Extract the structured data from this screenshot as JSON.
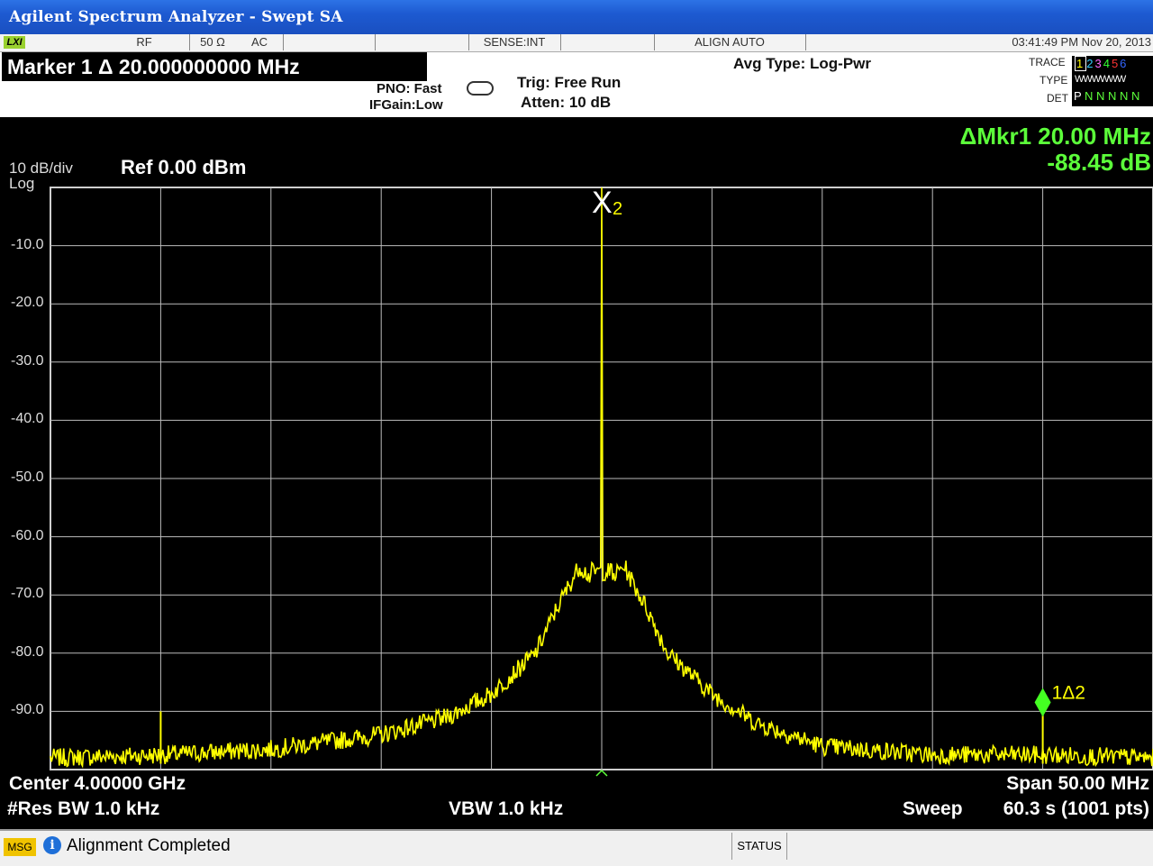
{
  "window": {
    "title": "Agilent Spectrum Analyzer - Swept SA"
  },
  "status_bar": {
    "lxi": "LXI",
    "rf": "RF",
    "impedance": "50 Ω",
    "coupling": "AC",
    "sense": "SENSE:INT",
    "align": "ALIGN AUTO",
    "datetime": "03:41:49 PM Nov 20, 2013"
  },
  "marker_readout": "Marker 1 Δ  20.000000000 MHz",
  "settings": {
    "pno": "PNO: Fast",
    "ifgain": "IFGain:Low",
    "trig": "Trig: Free Run",
    "atten": "Atten: 10 dB",
    "avg_type": "Avg Type: Log-Pwr"
  },
  "trace_panel": {
    "trace_label": "TRACE",
    "type_label": "TYPE",
    "det_label": "DET",
    "trace_numbers": [
      "1",
      "2",
      "3",
      "4",
      "5",
      "6"
    ],
    "trace_colors": [
      "#ffff00",
      "#33ccff",
      "#ff66ff",
      "#33ff33",
      "#ff3333",
      "#3366ff"
    ],
    "type_value": "WWWWWW",
    "det_value": "P N N N N N"
  },
  "display": {
    "scale": "10 dB/div",
    "scale_type": "Log",
    "ref_level": "Ref 0.00 dBm",
    "delta_marker": "ΔMkr1 20.00 MHz",
    "delta_value": "-88.45 dB",
    "marker_main_label": "X",
    "marker_main_sub": "2",
    "marker_delta_label": "1Δ2",
    "trace_color": "#ffff00",
    "marker_delta_color": "#44ff22"
  },
  "footer": {
    "center": "Center 4.00000 GHz",
    "res_bw": "#Res BW 1.0 kHz",
    "vbw": "VBW 1.0 kHz",
    "span": "Span 50.00 MHz",
    "sweep_label": "Sweep",
    "sweep_value": "60.3 s (1001 pts)"
  },
  "message_bar": {
    "tag": "MSG",
    "text": "Alignment Completed",
    "status": "STATUS"
  },
  "chart_data": {
    "type": "line",
    "title": "",
    "xlabel": "",
    "ylabel": "",
    "xlim_mhz": [
      3975,
      4025
    ],
    "ylim_dbm": [
      -100,
      0
    ],
    "y_ticks": [
      "-10.0",
      "-20.0",
      "-30.0",
      "-40.0",
      "-50.0",
      "-60.0",
      "-70.0",
      "-80.0",
      "-90.0"
    ],
    "grid": true,
    "series": [
      {
        "x": [
          3975,
          3980,
          3985,
          3990,
          3993,
          3995,
          3997,
          3998,
          3999,
          3999.5,
          4000,
          4000.5,
          4001,
          4002,
          4003,
          4005,
          4007,
          4010,
          4015,
          4020,
          4025
        ],
        "values": [
          -98,
          -97.5,
          -96.5,
          -94,
          -91,
          -87,
          -80,
          -72,
          -65,
          -67,
          0,
          -67,
          -65,
          -72,
          -80,
          -87,
          -92,
          -96,
          -97.5,
          -97.5,
          -98
        ]
      }
    ],
    "spurs": [
      {
        "x": 3980,
        "value": -90
      },
      {
        "x": 4020,
        "value": -88.45
      }
    ]
  }
}
